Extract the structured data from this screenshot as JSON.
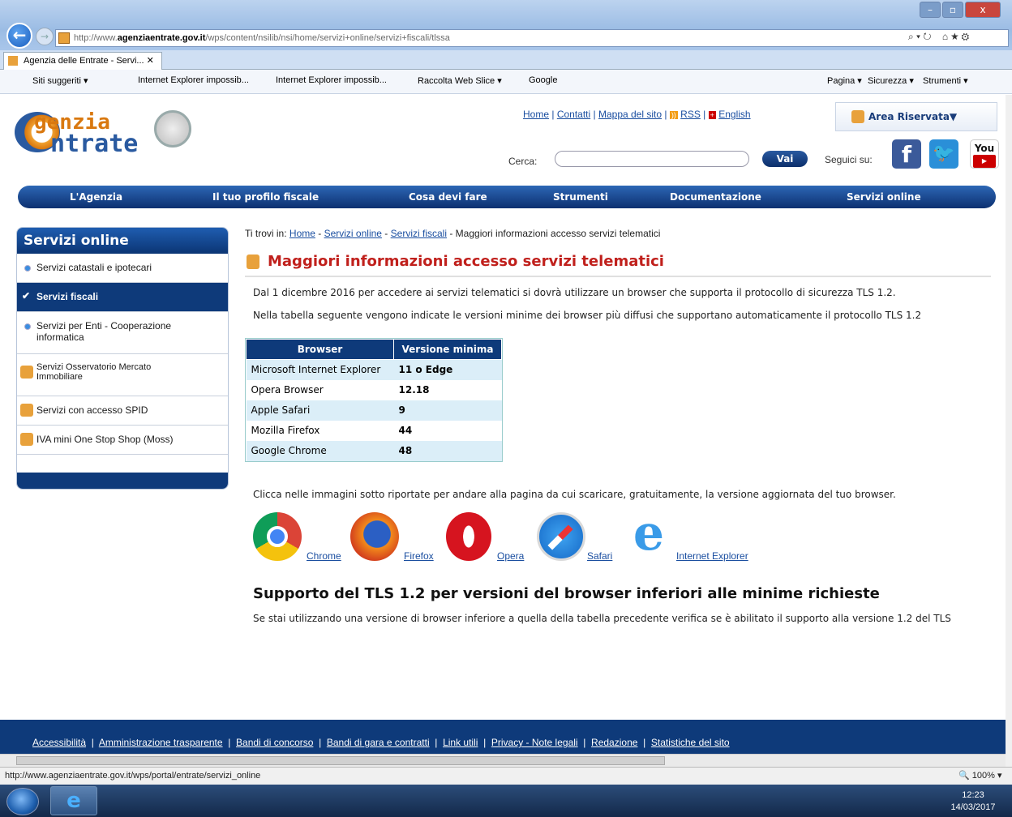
{
  "browser": {
    "url_prefix": "http://www.",
    "url_domain": "agenziaentrate.gov.it",
    "url_path": "/wps/content/nsilib/nsi/home/servizi+online/servizi+fiscali/tlssa",
    "tab_title": "Agenzia delle Entrate - Servi...",
    "favorites": [
      "Siti suggeriti ▾",
      "Internet Explorer impossib...",
      "Internet Explorer impossib...",
      "Raccolta Web Slice ▾",
      "Google"
    ],
    "toolbar_right": [
      "Pagina ▾",
      "Sicurezza ▾",
      "Strumenti ▾"
    ],
    "status_url": "http://www.agenziaentrate.gov.it/wps/portal/entrate/servizi_online",
    "zoom": "100%",
    "clock_time": "12:23",
    "clock_date": "14/03/2017"
  },
  "header": {
    "logo_top": "genzia",
    "logo_bottom": "ntrate",
    "top_links": [
      "Home",
      "Contatti",
      "Mappa del sito",
      "RSS",
      "English"
    ],
    "area_riservata": "Area Riservata▼",
    "search_label": "Cerca:",
    "search_button": "Vai",
    "follow_label": "Seguici su:",
    "youtube_label": "You"
  },
  "nav": [
    "L'Agenzia",
    "Il tuo profilo fiscale",
    "Cosa devi fare",
    "Strumenti",
    "Documentazione",
    "Servizi online"
  ],
  "sidebar": {
    "title": "Servizi online",
    "items": [
      "Servizi catastali e ipotecari",
      "Servizi fiscali",
      "Servizi per Enti - Cooperazione informatica",
      "Servizi Osservatorio Mercato Immobiliare",
      "Servizi con accesso SPID",
      "IVA mini One Stop Shop (Moss)"
    ]
  },
  "breadcrumb": {
    "prefix": "Ti trovi in:",
    "links": [
      "Home",
      "Servizi online",
      "Servizi fiscali"
    ],
    "current": "Maggiori informazioni accesso servizi telematici"
  },
  "content": {
    "title": "Maggiori informazioni accesso servizi telematici",
    "p1": "Dal 1 dicembre 2016 per accedere ai servizi telematici si dovrà utilizzare un browser che supporta il protocollo di sicurezza TLS 1.2.",
    "p2": "Nella tabella seguente vengono indicate le versioni minime dei browser più diffusi che supportano automaticamente il protocollo TLS 1.2",
    "table_headers": [
      "Browser",
      "Versione minima"
    ],
    "table_rows": [
      [
        "Microsoft Internet Explorer",
        "11 o Edge"
      ],
      [
        "Opera Browser",
        "12.18"
      ],
      [
        "Apple Safari",
        "9"
      ],
      [
        "Mozilla Firefox",
        "44"
      ],
      [
        "Google Chrome",
        "48"
      ]
    ],
    "p3": "Clicca nelle immagini sotto riportate per andare alla pagina da cui scaricare, gratuitamente, la versione aggiornata del tuo browser.",
    "browser_links": [
      "Chrome",
      "Firefox",
      "Opera",
      "Safari",
      "Internet Explorer"
    ],
    "h2": "Supporto del TLS 1.2 per versioni del browser inferiori alle minime richieste",
    "p4": "Se stai utilizzando una versione di browser inferiore a quella della tabella precedente verifica se è abilitato il supporto alla versione 1.2 del TLS"
  },
  "footer": [
    "Accessibilità",
    "Amministrazione trasparente",
    "Bandi di concorso",
    "Bandi di gara e contratti",
    "Link utili",
    "Privacy - Note legali",
    "Redazione",
    "Statistiche del sito"
  ],
  "colors": {
    "primary": "#0e3a7a",
    "title_red": "#c0201c",
    "accent_orange": "#e8a13b",
    "table_row": "#dbeef8"
  }
}
